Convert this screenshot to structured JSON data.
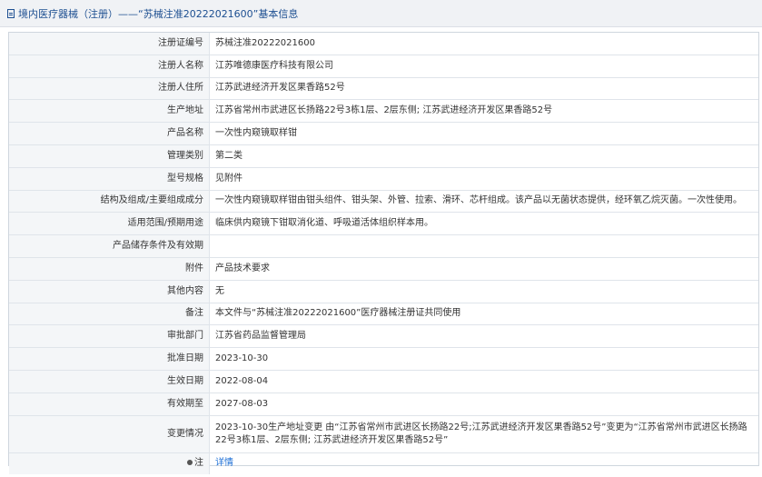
{
  "header": {
    "title": "境内医疗器械（注册）——“苏械注准20222021600”基本信息"
  },
  "rows": [
    {
      "label": "注册证编号",
      "value": "苏械注准20222021600"
    },
    {
      "label": "注册人名称",
      "value": "江苏唯德康医疗科技有限公司"
    },
    {
      "label": "注册人住所",
      "value": "江苏武进经济开发区果香路52号"
    },
    {
      "label": "生产地址",
      "value": "江苏省常州市武进区长扬路22号3栋1层、2层东侧; 江苏武进经济开发区果香路52号"
    },
    {
      "label": "产品名称",
      "value": "一次性内窥镜取样钳"
    },
    {
      "label": "管理类别",
      "value": "第二类"
    },
    {
      "label": "型号规格",
      "value": "见附件"
    },
    {
      "label": "结构及组成/主要组成成分",
      "value": "一次性内窥镜取样钳由钳头组件、钳头架、外管、拉索、滑环、芯杆组成。该产品以无菌状态提供，经环氧乙烷灭菌。一次性使用。"
    },
    {
      "label": "适用范围/预期用途",
      "value": "临床供内窥镜下钳取消化道、呼吸道活体组织样本用。"
    },
    {
      "label": "产品储存条件及有效期",
      "value": ""
    },
    {
      "label": "附件",
      "value": "产品技术要求"
    },
    {
      "label": "其他内容",
      "value": "无"
    },
    {
      "label": "备注",
      "value": "本文件与“苏械注准20222021600”医疗器械注册证共同使用"
    },
    {
      "label": "审批部门",
      "value": "江苏省药品监督管理局"
    },
    {
      "label": "批准日期",
      "value": "2023-10-30"
    },
    {
      "label": "生效日期",
      "value": "2022-08-04"
    },
    {
      "label": "有效期至",
      "value": "2027-08-03"
    },
    {
      "label": "变更情况",
      "value": "2023-10-30生产地址变更 由“江苏省常州市武进区长扬路22号;江苏武进经济开发区果香路52号”变更为“江苏省常州市武进区长扬路22号3栋1层、2层东侧; 江苏武进经济开发区果香路52号”"
    }
  ],
  "note": {
    "label": "注",
    "link": "详情"
  }
}
